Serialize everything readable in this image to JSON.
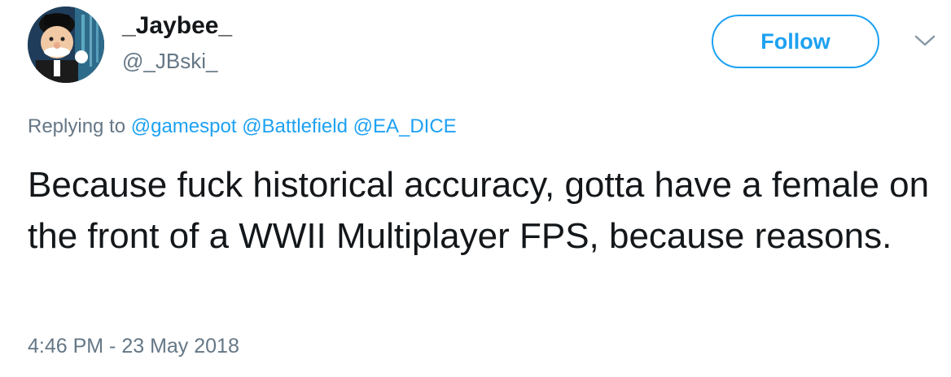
{
  "author": {
    "display_name": "_Jaybee_",
    "handle": "@_JBski_"
  },
  "follow_button": {
    "label": "Follow"
  },
  "menu": {
    "icon": "chevron-down-icon"
  },
  "reply": {
    "prefix": "Replying to",
    "mentions": [
      "@gamespot",
      "@Battlefield",
      "@EA_DICE"
    ]
  },
  "tweet": {
    "text": "Because fuck historical accuracy, gotta have a female on the front of a WWII Multiplayer FPS, because reasons.",
    "timestamp": "4:46 PM - 23 May 2018"
  },
  "colors": {
    "accent": "#1da1f2",
    "text": "#14171a",
    "secondary": "#657786"
  }
}
